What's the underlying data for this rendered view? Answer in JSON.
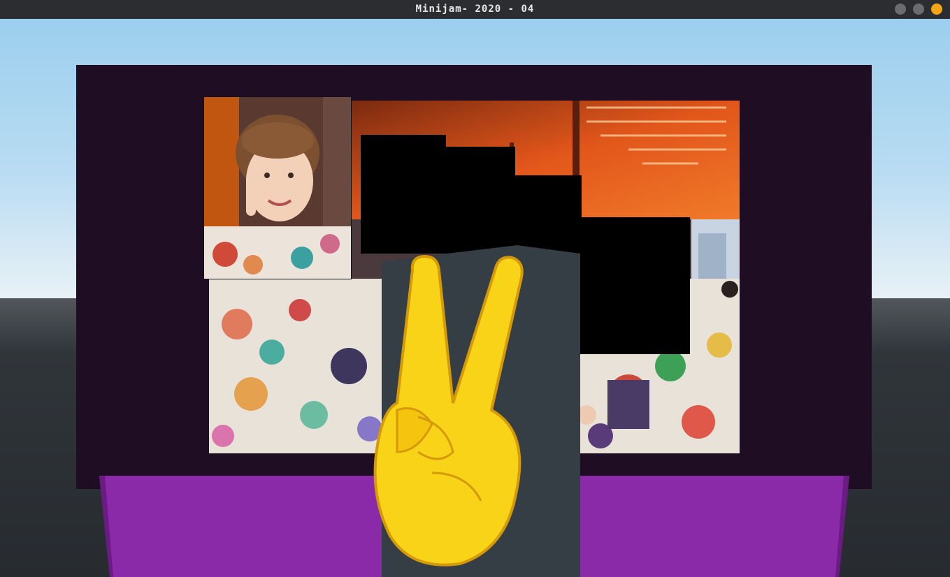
{
  "window": {
    "title": "Minijam- 2020 - 04",
    "buttons": [
      "minimize",
      "maximize",
      "close"
    ]
  },
  "scene": {
    "sky_color": "#9ccfee",
    "board_color": "#1f0d24",
    "stage_color": "#8a2aa8",
    "held_item": "peace-hand-icon",
    "missing_tiles_color": "#000000"
  }
}
